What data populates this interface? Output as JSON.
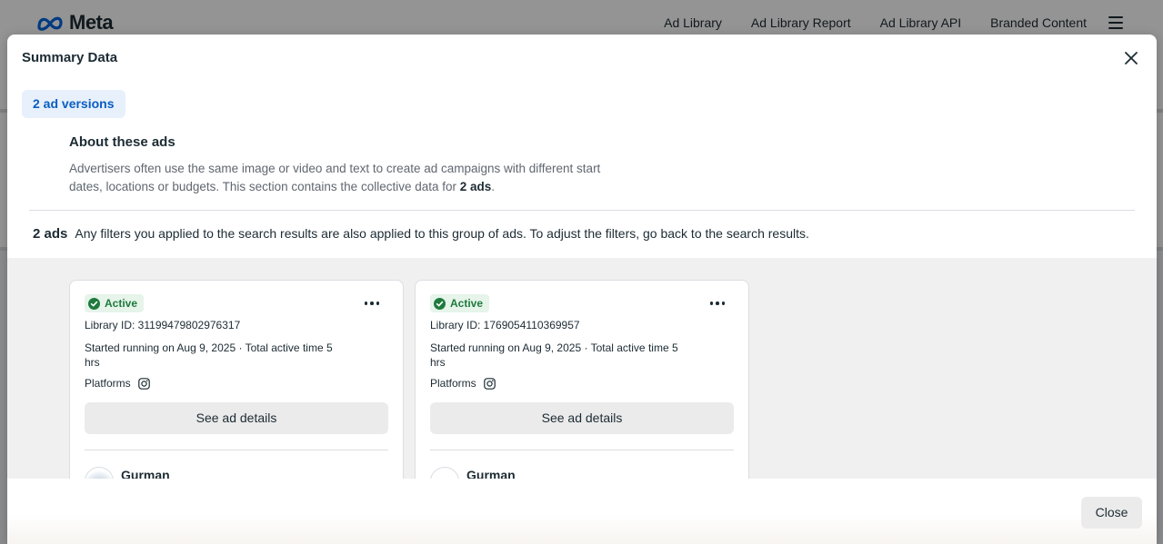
{
  "background": {
    "logo_text": "Meta",
    "nav": [
      "Ad Library",
      "Ad Library Report",
      "Ad Library API",
      "Branded Content"
    ],
    "menu_icon": "hamburger-icon"
  },
  "modal": {
    "title": "Summary Data",
    "close_icon": "close-icon",
    "tab_label": "2 ad versions",
    "about": {
      "heading": "About these ads",
      "text_before": "Advertisers often use the same image or video and text to create ad campaigns with different start dates, locations or budgets. This section contains the collective data for ",
      "text_bold": "2 ads",
      "text_after": "."
    },
    "ads_count": "2 ads",
    "ads_note": "Any filters you applied to the search results are also applied to this group of ads. To adjust the filters, go back to the search results.",
    "cards": [
      {
        "status": "Active",
        "library_id": "Library ID: 31199479802976317",
        "started": "Started running on Aug 9, 2025 · Total active time 5 hrs",
        "platforms_label": "Platforms",
        "platform_icon": "instagram-icon",
        "details_button": "See ad details",
        "advertiser": "Gurman"
      },
      {
        "status": "Active",
        "library_id": "Library ID: 1769054110369957",
        "started": "Started running on Aug 9, 2025 · Total active time 5 hrs",
        "platforms_label": "Platforms",
        "platform_icon": "instagram-icon",
        "details_button": "See ad details",
        "advertiser": "Gurman"
      }
    ],
    "footer_close": "Close"
  },
  "colors": {
    "accent_blue": "#0a5dc2",
    "tab_bg": "#e7f0fb",
    "active_green": "#1f7a3d",
    "active_bg": "#e6f4ea",
    "button_grey": "#ebebeb",
    "meta_blue": "#0064e0"
  }
}
